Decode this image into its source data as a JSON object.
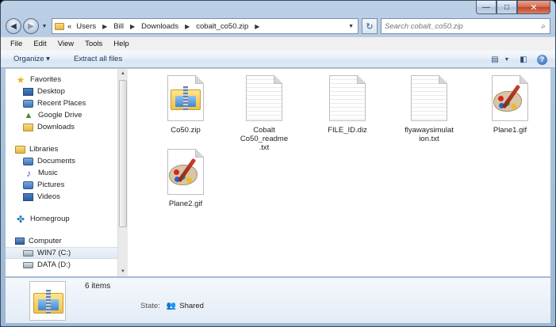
{
  "window": {
    "controls": {
      "minimize": "—",
      "maximize": "□",
      "close": "✕"
    }
  },
  "nav": {
    "back": "◀",
    "forward": "▶",
    "overflow": "«",
    "breadcrumbs": [
      "Users",
      "Bill",
      "Downloads",
      "cobalt_co50.zip"
    ],
    "search_placeholder": "Search cobalt_co50.zip"
  },
  "menu": [
    "File",
    "Edit",
    "View",
    "Tools",
    "Help"
  ],
  "commands": {
    "organize": "Organize ▾",
    "extract": "Extract all files"
  },
  "sidebar": {
    "favorites": {
      "label": "Favorites",
      "items": [
        "Desktop",
        "Recent Places",
        "Google Drive",
        "Downloads"
      ]
    },
    "libraries": {
      "label": "Libraries",
      "items": [
        "Documents",
        "Music",
        "Pictures",
        "Videos"
      ]
    },
    "homegroup": {
      "label": "Homegroup"
    },
    "computer": {
      "label": "Computer",
      "items": [
        "WIN7 (C:)",
        "DATA (D:)"
      ]
    }
  },
  "files": [
    {
      "name": "Co50.zip",
      "kind": "zip"
    },
    {
      "name": "Cobalt Co50_readme.txt",
      "kind": "txt"
    },
    {
      "name": "FILE_ID.diz",
      "kind": "txt"
    },
    {
      "name": "flyawaysimulation.txt",
      "kind": "txt"
    },
    {
      "name": "Plane1.gif",
      "kind": "gif"
    },
    {
      "name": "Plane2.gif",
      "kind": "gif"
    }
  ],
  "details": {
    "count": "6 items",
    "state_label": "State:",
    "state_value": "Shared"
  },
  "colors": {
    "accent": "#1e395b",
    "selection": "#dfe8f3"
  }
}
